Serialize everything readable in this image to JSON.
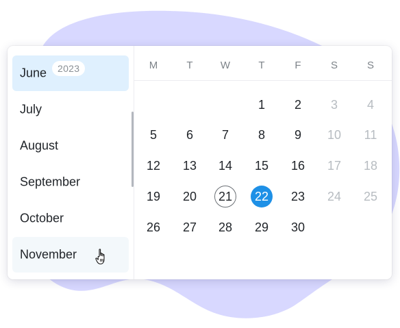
{
  "months": [
    {
      "label": "June",
      "state": "selected",
      "badge": "2023"
    },
    {
      "label": "July",
      "state": "normal"
    },
    {
      "label": "August",
      "state": "normal"
    },
    {
      "label": "September",
      "state": "normal"
    },
    {
      "label": "October",
      "state": "normal"
    },
    {
      "label": "November",
      "state": "hovered"
    }
  ],
  "weekdays": [
    "M",
    "T",
    "W",
    "T",
    "F",
    "S",
    "S"
  ],
  "weeks": [
    [
      "",
      "",
      "",
      "1",
      "2",
      "3",
      "4"
    ],
    [
      "5",
      "6",
      "7",
      "8",
      "9",
      "10",
      "11"
    ],
    [
      "12",
      "13",
      "14",
      "15",
      "16",
      "17",
      "18"
    ],
    [
      "19",
      "20",
      "21",
      "22",
      "23",
      "24",
      "25"
    ],
    [
      "26",
      "27",
      "28",
      "29",
      "30",
      "",
      ""
    ]
  ],
  "today": "21",
  "selected_day": "22",
  "colors": {
    "accent": "#1e90e6",
    "blob": "#d8d8ff",
    "month_selected_bg": "#dff0fe",
    "month_hover_bg": "#f3f8fb",
    "weekend_text": "#b7bcc1"
  },
  "icons": {
    "cursor": "hand-pointer-icon"
  }
}
